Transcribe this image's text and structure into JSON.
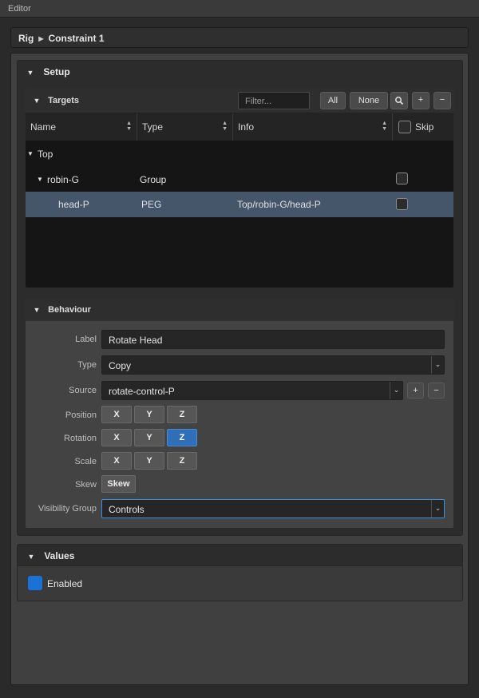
{
  "window": {
    "title": "Editor"
  },
  "breadcrumb": {
    "root": "Rig",
    "current": "Constraint 1"
  },
  "setup": {
    "title": "Setup",
    "targets": {
      "title": "Targets",
      "filter_placeholder": "Filter...",
      "buttons": {
        "all": "All",
        "none": "None",
        "search": "search-icon",
        "add": "+",
        "remove": "−"
      },
      "columns": [
        "Name",
        "Type",
        "Info",
        "Skip"
      ],
      "rows": [
        {
          "name": "Top",
          "type": "",
          "info": "",
          "skip": false,
          "level": 0,
          "expanded": true
        },
        {
          "name": "robin-G",
          "type": "Group",
          "info": "",
          "skip": false,
          "level": 1,
          "expanded": true
        },
        {
          "name": "head-P",
          "type": "PEG",
          "info": "Top/robin-G/head-P",
          "skip": false,
          "level": 2,
          "selected": true
        }
      ]
    },
    "behaviour": {
      "title": "Behaviour",
      "label": {
        "label": "Label",
        "value": "Rotate Head"
      },
      "type": {
        "label": "Type",
        "value": "Copy"
      },
      "source": {
        "label": "Source",
        "value": "rotate-control-P",
        "add": "+",
        "remove": "−"
      },
      "position": {
        "label": "Position",
        "axes": [
          "X",
          "Y",
          "Z"
        ],
        "active": []
      },
      "rotation": {
        "label": "Rotation",
        "axes": [
          "X",
          "Y",
          "Z"
        ],
        "active": [
          "Z"
        ]
      },
      "scale": {
        "label": "Scale",
        "axes": [
          "X",
          "Y",
          "Z"
        ],
        "active": []
      },
      "skew": {
        "label": "Skew",
        "button": "Skew"
      },
      "visibility_group": {
        "label": "Visibility Group",
        "value": "Controls"
      }
    }
  },
  "values": {
    "title": "Values",
    "enabled_label": "Enabled",
    "enabled": true
  },
  "colors": {
    "accent": "#1a72d8",
    "selected_row": "#45556a",
    "active_axis": "#2f6fb8"
  }
}
